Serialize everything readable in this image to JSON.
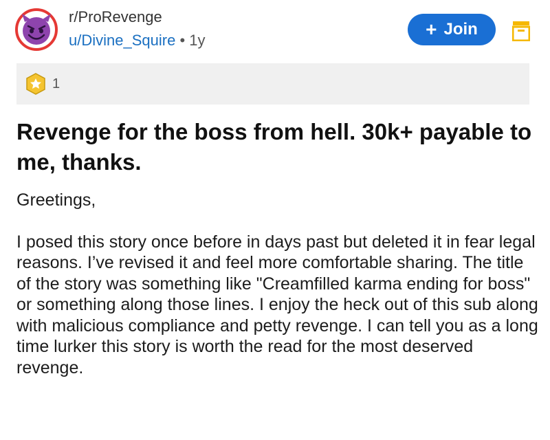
{
  "post": {
    "subreddit": "r/ProRevenge",
    "author": "u/Divine_Squire",
    "separator": "•",
    "age": "1y",
    "join_label": "Join",
    "award_count": "1",
    "title": "Revenge for the boss from hell. 30k+ payable to me, thanks.",
    "greeting": "Greetings,",
    "body": "I posed this story once before in days past but deleted it in fear legal reasons. I’ve revised it and feel more comfortable sharing. The title of the story was something like \"Creamfilled karma ending for boss\" or something along those lines. I enjoy the heck out of this sub along with malicious compliance and petty revenge. I can tell you as a long time lurker this story is worth the read for the most deserved revenge."
  },
  "icons": {
    "avatar": "devil-emoji-icon",
    "join": "plus-icon",
    "save": "save-icon",
    "award": "star-award-icon"
  },
  "colors": {
    "accent": "#1a6fd4",
    "avatar_ring": "#e53935",
    "avatar_face": "#8e44ad",
    "save_icon": "#f5b800",
    "award_bar": "#f0f0f0"
  }
}
